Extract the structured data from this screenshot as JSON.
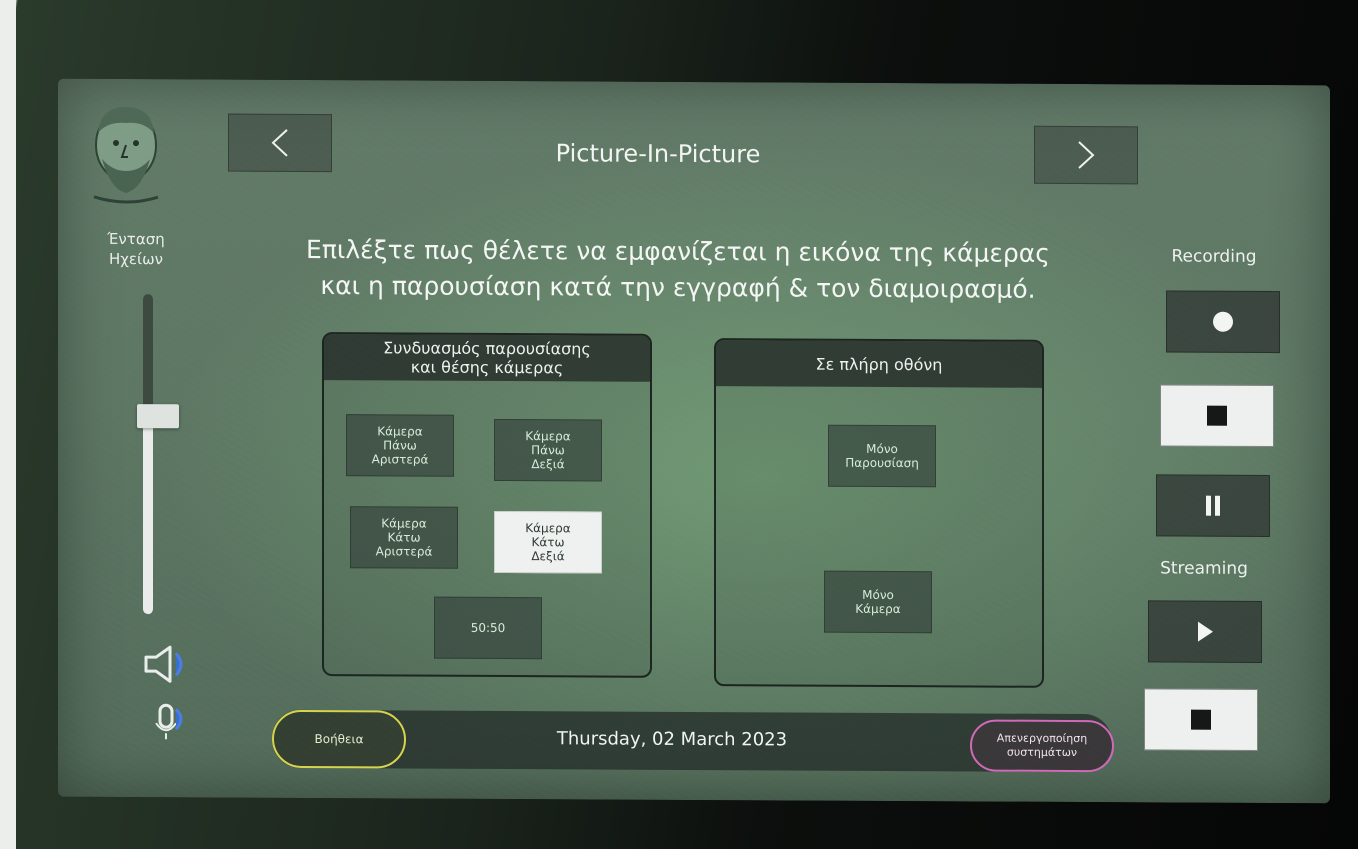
{
  "header": {
    "title": "Picture-In-Picture",
    "prev_icon": "chevron-left-icon",
    "next_icon": "chevron-right-icon"
  },
  "volume": {
    "label_line1": "Ένταση",
    "label_line2": "Ηχείων",
    "level": 0.62,
    "speaker_icon": "speaker-icon",
    "mic_icon": "microphone-icon"
  },
  "instructions": {
    "line1": "Επιλέξτε πως θέλετε να εμφανίζεται η εικόνα της κάμερας",
    "line2": "και η παρουσίαση κατά την εγγραφή & τον διαμοιρασμό."
  },
  "combo_panel": {
    "title_line1": "Συνδυασμός παρουσίασης",
    "title_line2": "και θέσης κάμερας",
    "buttons": [
      {
        "line1": "Κάμερα",
        "line2": "Πάνω",
        "line3": "Αριστερά",
        "selected": false
      },
      {
        "line1": "Κάμερα",
        "line2": "Πάνω",
        "line3": "Δεξιά",
        "selected": false
      },
      {
        "line1": "Κάμερα",
        "line2": "Κάτω",
        "line3": "Αριστερά",
        "selected": false
      },
      {
        "line1": "Κάμερα",
        "line2": "Κάτω",
        "line3": "Δεξιά",
        "selected": true
      }
    ],
    "split_button": "50:50"
  },
  "fullscreen_panel": {
    "title": "Σε πλήρη οθόνη",
    "buttons": [
      {
        "line1": "Μόνο",
        "line2": "Παρουσίαση"
      },
      {
        "line1": "Μόνο",
        "line2": "Κάμερα"
      }
    ]
  },
  "recording": {
    "label": "Recording",
    "record_icon": "record-icon",
    "stop_icon": "stop-icon",
    "pause_icon": "pause-icon"
  },
  "streaming": {
    "label": "Streaming",
    "play_icon": "play-icon",
    "stop_icon": "stop-icon"
  },
  "footer": {
    "help_label": "Βοήθεια",
    "date": "Thursday, 02 March 2023",
    "shutdown_line1": "Απενεργοποίηση",
    "shutdown_line2": "συστημάτων"
  },
  "colors": {
    "help_border": "#d6d44e",
    "shutdown_border": "#d06ab8",
    "screen_bg": "#56705d"
  }
}
